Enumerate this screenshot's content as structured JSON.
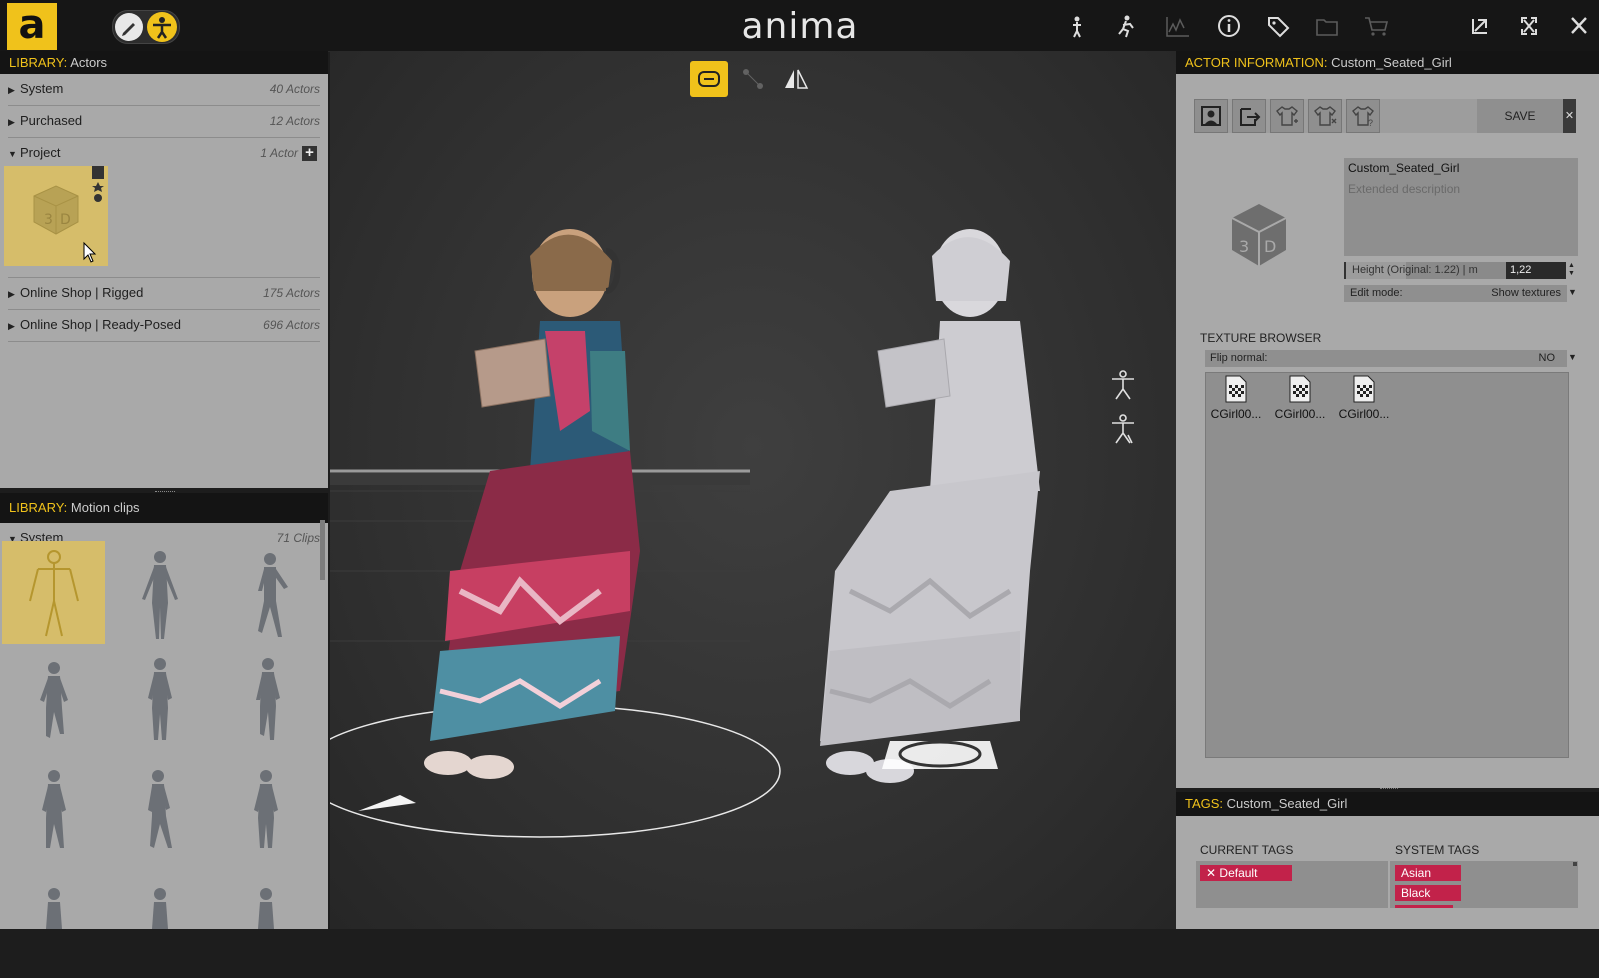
{
  "app": {
    "logo": "a",
    "title": "anima"
  },
  "toolbar": {
    "icons": [
      "actor-icon",
      "motion-icon",
      "graph-icon",
      "info-icon",
      "tag-icon",
      "folder-icon",
      "cart-icon"
    ]
  },
  "actors_library": {
    "prefix": "LIBRARY:",
    "title": "Actors",
    "rows": [
      {
        "label": "System",
        "count": "40 Actors"
      },
      {
        "label": "Purchased",
        "count": "12 Actors"
      },
      {
        "label": "Project",
        "count": "1 Actor"
      },
      {
        "label": "Online Shop | Rigged",
        "count": "175 Actors"
      },
      {
        "label": "Online Shop | Ready-Posed",
        "count": "696 Actors"
      }
    ]
  },
  "clips_library": {
    "prefix": "LIBRARY:",
    "title": "Motion clips",
    "section": {
      "label": "System",
      "count": "71 Clips"
    }
  },
  "actor_info": {
    "prefix": "ACTOR INFORMATION:",
    "actor_name": "Custom_Seated_Girl",
    "save_label": "SAVE",
    "close_label": "✕",
    "name_value": "Custom_Seated_Girl",
    "description_placeholder": "Extended description",
    "height_label": "Height (Original: 1.22)  |  m",
    "height_value": "1,22",
    "edit_mode_label": "Edit mode:",
    "edit_mode_value": "Show textures",
    "texture_browser_label": "TEXTURE BROWSER",
    "flip_normal_label": "Flip normal:",
    "flip_normal_value": "NO",
    "textures": [
      "CGirl00...",
      "CGirl00...",
      "CGirl00..."
    ]
  },
  "tags": {
    "prefix": "TAGS:",
    "actor_name": "Custom_Seated_Girl",
    "current_label": "CURRENT TAGS",
    "system_label": "SYSTEM TAGS",
    "current": [
      "Default"
    ],
    "system": [
      "Asian",
      "Black"
    ]
  },
  "colors": {
    "accent": "#f0c21b",
    "tag": "#c2224a",
    "panel": "#a9a9a9"
  }
}
